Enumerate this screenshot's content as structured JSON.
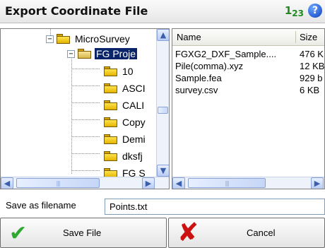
{
  "window": {
    "title": "Export Coordinate File",
    "units_badge_main": "1",
    "units_badge_sub": "23",
    "help_glyph": "?"
  },
  "tree": {
    "root": {
      "label": "MicroSurvey",
      "expander": "−",
      "icon": "folder-icon"
    },
    "selected": {
      "label": "FG Proje",
      "expander": "−",
      "icon": "folder-open-icon"
    },
    "children": [
      {
        "label": "10"
      },
      {
        "label": "ASCI"
      },
      {
        "label": "CALI"
      },
      {
        "label": "Copy"
      },
      {
        "label": "Demi"
      },
      {
        "label": "dksfj"
      },
      {
        "label": "FG S"
      }
    ]
  },
  "file_list": {
    "columns": [
      "Name",
      "Size"
    ],
    "rows": [
      {
        "name": "FGXG2_DXF_Sample....",
        "size": "476 K"
      },
      {
        "name": "Pile(comma).xyz",
        "size": "12 KB"
      },
      {
        "name": "Sample.fea",
        "size": "929 b"
      },
      {
        "name": "survey.csv",
        "size": "6 KB"
      }
    ]
  },
  "filename": {
    "label": "Save as filename",
    "value": "Points.txt"
  },
  "buttons": {
    "save_label": "Save File",
    "cancel_label": "Cancel"
  },
  "scroll_glyphs": {
    "up": "▲",
    "down": "▼",
    "left": "◀",
    "right": "▶",
    "grip": "|||"
  },
  "colors": {
    "selection": "#0a246a",
    "save_icon": "#2fa82f",
    "cancel_icon": "#cc1111",
    "units_badge": "#1f8a1f",
    "help_badge": "#0d3fbf"
  }
}
